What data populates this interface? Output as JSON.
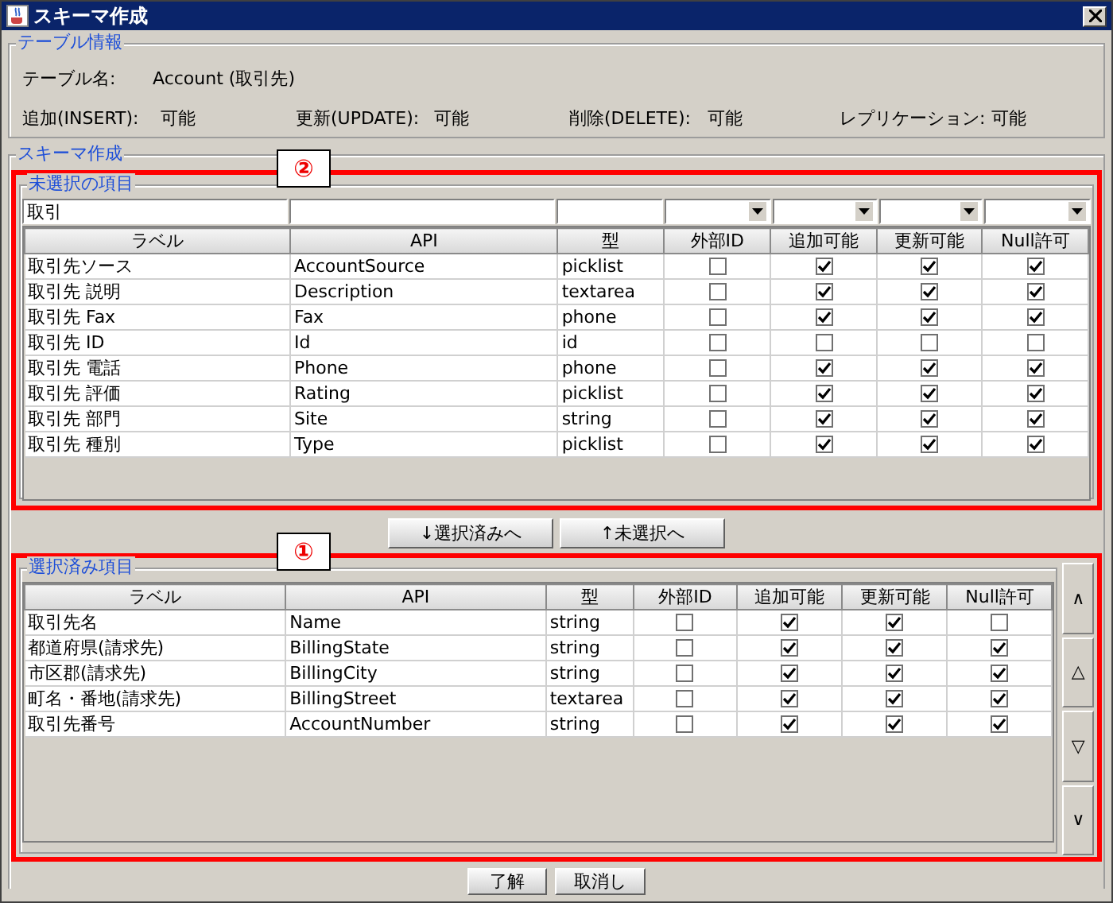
{
  "window": {
    "title": "スキーマ作成"
  },
  "table_info": {
    "legend": "テーブル情報",
    "name_label": "テーブル名:",
    "name_value": "Account (取引先)",
    "permissions": [
      {
        "label": "追加(INSERT):",
        "value": "可能"
      },
      {
        "label": "更新(UPDATE):",
        "value": "可能"
      },
      {
        "label": "削除(DELETE):",
        "value": "可能"
      },
      {
        "label": "レプリケーション:",
        "value": "可能"
      }
    ]
  },
  "schema": {
    "legend": "スキーマ作成",
    "unselected": {
      "callout": "②",
      "legend": "未選択の項目",
      "filters": [
        {
          "kind": "text",
          "value": "取引"
        },
        {
          "kind": "text"
        },
        {
          "kind": "text"
        },
        {
          "kind": "combo"
        },
        {
          "kind": "combo"
        },
        {
          "kind": "combo"
        },
        {
          "kind": "combo"
        }
      ],
      "columns": [
        "ラベル",
        "API",
        "型",
        "外部ID",
        "追加可能",
        "更新可能",
        "Null許可"
      ],
      "rows": [
        {
          "label": "取引先ソース",
          "api": "AccountSource",
          "type": "picklist",
          "external_id": false,
          "creatable": true,
          "updatable": true,
          "nillable": true
        },
        {
          "label": "取引先 説明",
          "api": "Description",
          "type": "textarea",
          "external_id": false,
          "creatable": true,
          "updatable": true,
          "nillable": true
        },
        {
          "label": "取引先 Fax",
          "api": "Fax",
          "type": "phone",
          "external_id": false,
          "creatable": true,
          "updatable": true,
          "nillable": true
        },
        {
          "label": "取引先 ID",
          "api": "Id",
          "type": "id",
          "external_id": false,
          "creatable": false,
          "updatable": false,
          "nillable": false
        },
        {
          "label": "取引先 電話",
          "api": "Phone",
          "type": "phone",
          "external_id": false,
          "creatable": true,
          "updatable": true,
          "nillable": true
        },
        {
          "label": "取引先 評価",
          "api": "Rating",
          "type": "picklist",
          "external_id": false,
          "creatable": true,
          "updatable": true,
          "nillable": true
        },
        {
          "label": "取引先 部門",
          "api": "Site",
          "type": "string",
          "external_id": false,
          "creatable": true,
          "updatable": true,
          "nillable": true
        },
        {
          "label": "取引先 種別",
          "api": "Type",
          "type": "picklist",
          "external_id": false,
          "creatable": true,
          "updatable": true,
          "nillable": true
        }
      ]
    },
    "move_buttons": [
      "↓選択済みへ",
      "↑未選択へ"
    ],
    "selected": {
      "callout": "①",
      "legend": "選択済み項目",
      "columns": [
        "ラベル",
        "API",
        "型",
        "外部ID",
        "追加可能",
        "更新可能",
        "Null許可"
      ],
      "rows": [
        {
          "label": "取引先名",
          "api": "Name",
          "type": "string",
          "external_id": false,
          "creatable": true,
          "updatable": true,
          "nillable": false
        },
        {
          "label": "都道府県(請求先)",
          "api": "BillingState",
          "type": "string",
          "external_id": false,
          "creatable": true,
          "updatable": true,
          "nillable": true
        },
        {
          "label": "市区郡(請求先)",
          "api": "BillingCity",
          "type": "string",
          "external_id": false,
          "creatable": true,
          "updatable": true,
          "nillable": true
        },
        {
          "label": "町名・番地(請求先)",
          "api": "BillingStreet",
          "type": "textarea",
          "external_id": false,
          "creatable": true,
          "updatable": true,
          "nillable": true
        },
        {
          "label": "取引先番号",
          "api": "AccountNumber",
          "type": "string",
          "external_id": false,
          "creatable": true,
          "updatable": true,
          "nillable": true
        }
      ],
      "order_buttons": [
        "∧",
        "△",
        "▽",
        "∨"
      ]
    }
  },
  "buttons": [
    "了解",
    "取消し"
  ]
}
